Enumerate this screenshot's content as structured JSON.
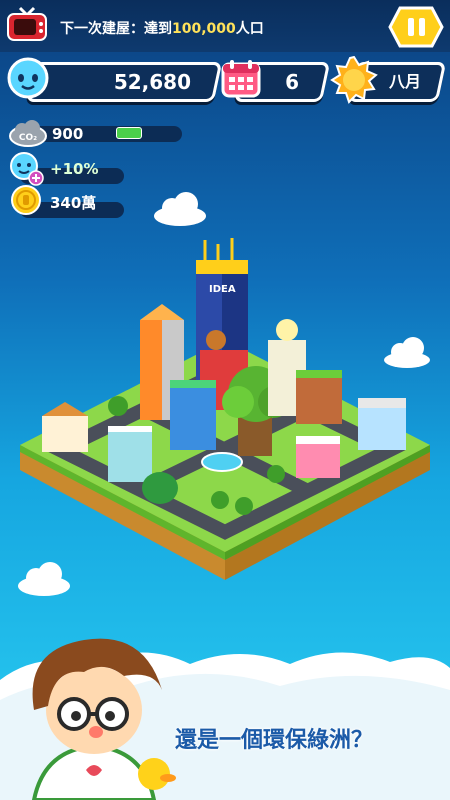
{
  "header": {
    "goal_prefix": "下一次建屋：達到",
    "goal_number": "100,000",
    "goal_suffix": "人口"
  },
  "stats": {
    "population": "52,680",
    "calendar_day": "6",
    "month": "八月"
  },
  "side_stats": {
    "co2_label": "CO₂",
    "co2_value": "900",
    "happiness_bonus": "+10%",
    "coins": "340萬"
  },
  "island": {
    "building_sign": "IDEA"
  },
  "banner": {
    "text": "還是一個環保綠洲？"
  },
  "colors": {
    "pill_border": "#ffffff",
    "accent_yellow": "#ffcf1a",
    "grass": "#8dd84a"
  }
}
